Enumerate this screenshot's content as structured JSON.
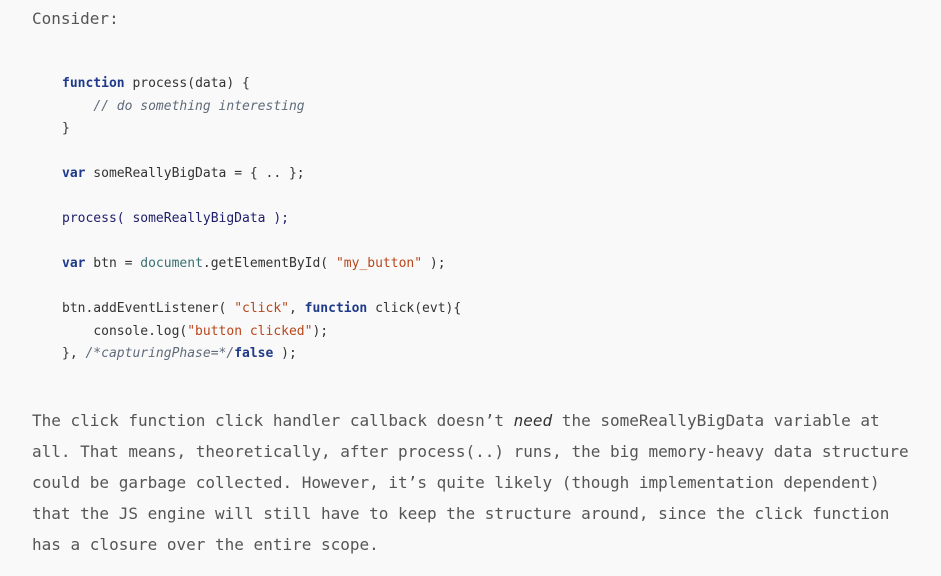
{
  "intro": "Consider:",
  "code": {
    "l1_kw": "function",
    "l1_rest": " process(data) {",
    "l2_indent": "    ",
    "l2_comment": "// do something interesting",
    "l3": "}",
    "l5_kw": "var",
    "l5_rest": " someReallyBigData = { .. };",
    "l7": "process( someReallyBigData );",
    "l9_kw": "var",
    "l9_mid1": " btn = ",
    "l9_doc": "document",
    "l9_mid2": ".getElementById( ",
    "l9_str": "\"my_button\"",
    "l9_end": " );",
    "l11_a": "btn.addEventListener( ",
    "l11_str": "\"click\"",
    "l11_b": ", ",
    "l11_kw": "function",
    "l11_c": " click(evt){",
    "l12_indent": "    ",
    "l12_a": "console.log(",
    "l12_str": "\"button clicked\"",
    "l12_b": ");",
    "l13_a": "}, ",
    "l13_comment": "/*capturingPhase=*/",
    "l13_kw": "false",
    "l13_b": " );"
  },
  "paragraph": {
    "part1": "The click function click handler callback doesn’t ",
    "emphasis": "need",
    "part2": " the someReallyBigData variable at all. That means, theoretically, after process(..) runs, the big memory-heavy data structure could be garbage collected. However, it’s quite likely (though implementation dependent) that the JS engine will still have to keep the structure around, since the click function has a closure over the entire scope."
  }
}
